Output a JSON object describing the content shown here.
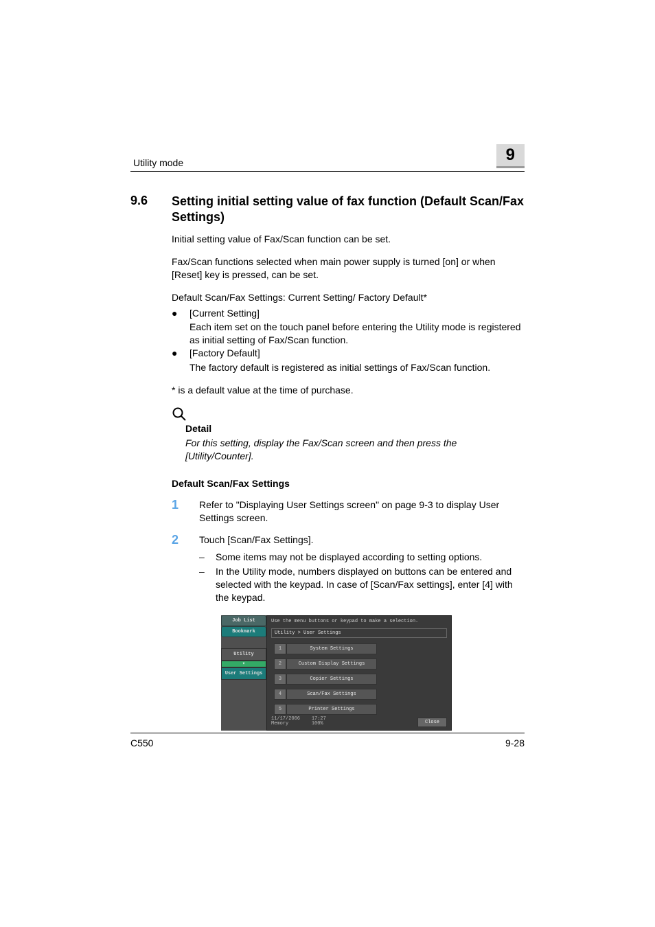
{
  "header": {
    "running": "Utility mode",
    "chapter": "9"
  },
  "section": {
    "number": "9.6",
    "title": "Setting initial setting value of fax function (Default Scan/Fax Settings)"
  },
  "paras": {
    "p1": "Initial setting value of Fax/Scan function can be set.",
    "p2": "Fax/Scan functions selected when main power supply is turned [on] or when [Reset] key is pressed, can be set.",
    "p3": "Default Scan/Fax Settings: Current Setting/ Factory Default*",
    "note_star": "* is a default value at the time of purchase."
  },
  "bullets": {
    "b1_title": "[Current Setting]",
    "b1_body": "Each item set on the touch panel before entering the Utility mode is registered as initial setting of Fax/Scan function.",
    "b2_title": "[Factory Default]",
    "b2_body": "The factory default is registered as initial settings of Fax/Scan function."
  },
  "detail": {
    "heading": "Detail",
    "body": "For this setting, display the Fax/Scan screen and then press the [Utility/Counter]."
  },
  "subheading": "Default Scan/Fax Settings",
  "steps": {
    "s1_num": "1",
    "s1_body": "Refer to \"Displaying User Settings screen\" on page 9-3 to display User Settings screen.",
    "s2_num": "2",
    "s2_body": "Touch [Scan/Fax Settings].",
    "s2_d1": "Some items may not be displayed according to setting options.",
    "s2_d2": "In the Utility mode, numbers displayed on buttons can be entered and selected with the keypad. In case of [Scan/Fax settings], enter [4] with the keypad."
  },
  "screen": {
    "hint": "Use the menu buttons or keypad to make a selection.",
    "tab_joblist": "Job List",
    "tab_bookmark": "Bookmark",
    "side_utility": "Utility",
    "side_arrow": "▾",
    "side_usersettings": "User Settings",
    "crumb": "Utility > User Settings",
    "items": [
      {
        "n": "1",
        "label": "System Settings"
      },
      {
        "n": "2",
        "label": "Custom Display Settings"
      },
      {
        "n": "3",
        "label": "Copier Settings"
      },
      {
        "n": "4",
        "label": "Scan/Fax Settings"
      },
      {
        "n": "5",
        "label": "Printer Settings"
      }
    ],
    "date": "11/17/2006",
    "time": "17:27",
    "mem_label": "Memory",
    "mem_val": "100%",
    "close": "Close"
  },
  "footer": {
    "model": "C550",
    "page": "9-28"
  }
}
